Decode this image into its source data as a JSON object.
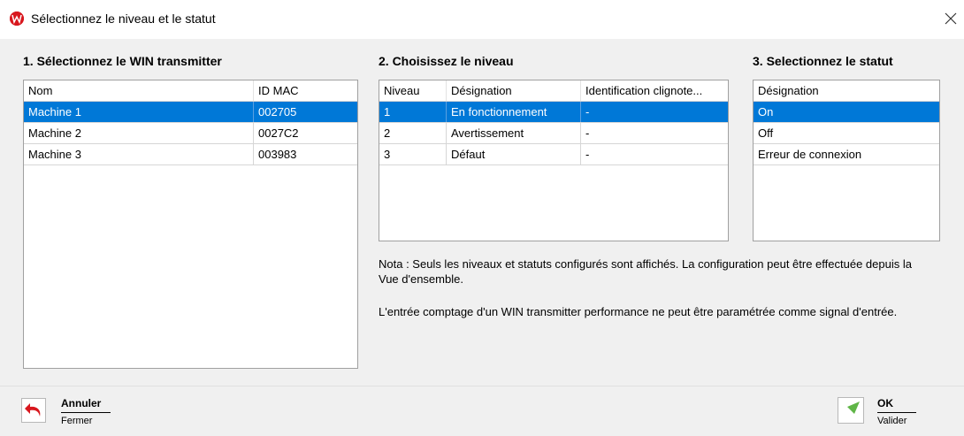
{
  "window": {
    "title": "Sélectionnez le niveau et le statut",
    "close_glyph": "✕",
    "app_icon_text": "WH"
  },
  "section1": {
    "title": "1. Sélectionnez le WIN transmitter",
    "columns": [
      "Nom",
      "ID MAC"
    ],
    "rows": [
      [
        "Machine 1",
        "002705"
      ],
      [
        "Machine 2",
        "0027C2"
      ],
      [
        "Machine 3",
        "003983"
      ]
    ],
    "selected_row": 0
  },
  "section2": {
    "title": "2. Choisissez le niveau",
    "columns": [
      "Niveau",
      "Désignation",
      "Identification clignote..."
    ],
    "rows": [
      [
        "1",
        "En fonctionnement",
        "-"
      ],
      [
        "2",
        "Avertissement",
        "-"
      ],
      [
        "3",
        "Défaut",
        "-"
      ]
    ],
    "selected_row": 0
  },
  "section3": {
    "title": "3. Selectionnez le statut",
    "columns": [
      "Désignation"
    ],
    "rows": [
      [
        "On"
      ],
      [
        "Off"
      ],
      [
        "Erreur de connexion"
      ]
    ],
    "selected_row": 0
  },
  "notes": {
    "line1": "Nota : Seuls les niveaux et statuts configurés sont affichés. La configuration peut être effectuée depuis  la",
    "line2": "Vue d'ensemble.",
    "line3": "L'entrée comptage d'un WIN transmitter performance ne peut être paramétrée comme signal d'entrée."
  },
  "footer": {
    "cancel": {
      "label": "Annuler",
      "sub": "Fermer",
      "icon": "undo-arrow-icon"
    },
    "ok": {
      "label": "OK",
      "sub": "Valider",
      "icon": "check-arrow-icon"
    }
  },
  "colors": {
    "selection": "#0078d7",
    "cancel_icon": "#d8171e",
    "ok_icon": "#5fb547",
    "app_icon": "#d8171e"
  }
}
